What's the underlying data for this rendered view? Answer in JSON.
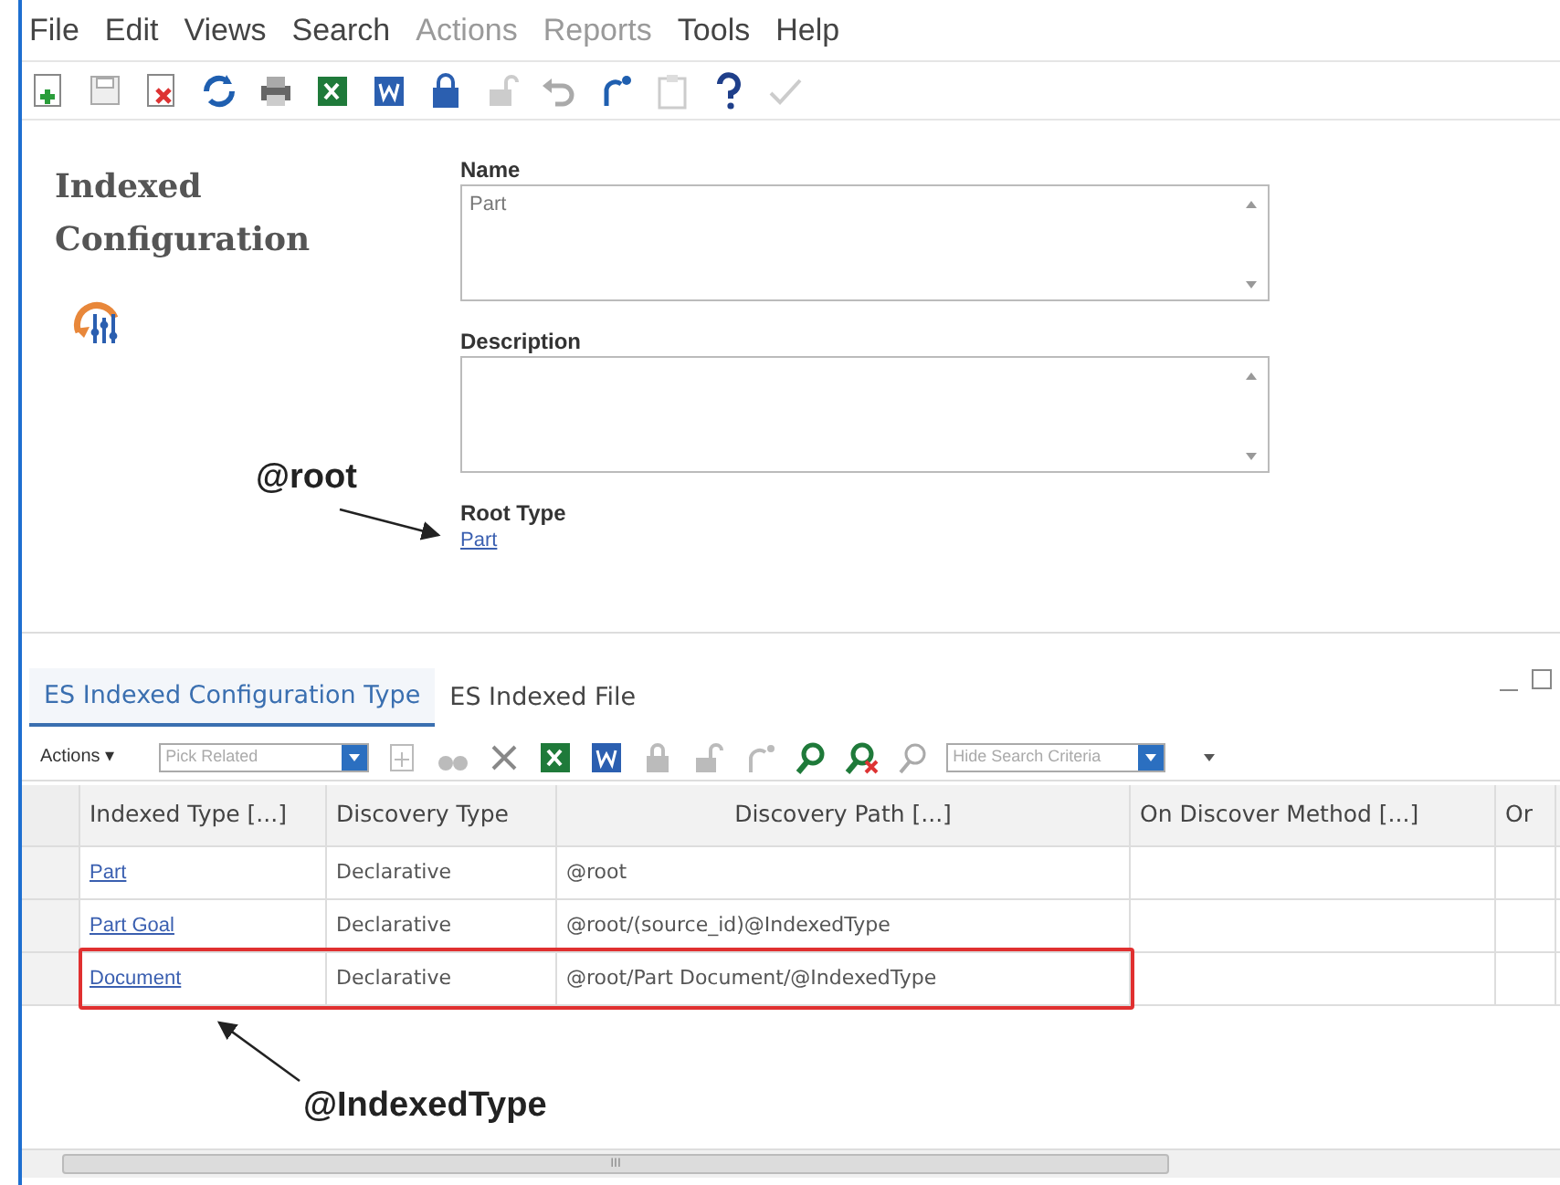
{
  "menu": [
    {
      "label": "File",
      "disabled": false
    },
    {
      "label": "Edit",
      "disabled": false
    },
    {
      "label": "Views",
      "disabled": false
    },
    {
      "label": "Search",
      "disabled": false
    },
    {
      "label": "Actions",
      "disabled": true
    },
    {
      "label": "Reports",
      "disabled": true
    },
    {
      "label": "Tools",
      "disabled": false
    },
    {
      "label": "Help",
      "disabled": false
    }
  ],
  "form": {
    "title": "Indexed Configuration",
    "name_label": "Name",
    "name_value": "Part",
    "description_label": "Description",
    "root_type_label": "Root Type",
    "root_type_value": "Part"
  },
  "annotations": [
    {
      "text": "@root"
    },
    {
      "text": "@IndexedType"
    }
  ],
  "tabs": [
    {
      "label": "ES Indexed Configuration Type",
      "selected": true
    },
    {
      "label": "ES Indexed File",
      "selected": false
    }
  ],
  "grid_toolbar": {
    "actions": "Actions",
    "actions_caret": "▾",
    "pick_related": "Pick Related",
    "search_criteria": "Hide Search Criteria"
  },
  "table": {
    "columns": [
      "Indexed Type [...]",
      "Discovery Type",
      "Discovery Path [...]",
      "On Discover Method [...]",
      "Or"
    ],
    "rows": [
      {
        "cells": [
          "Part",
          "Declarative",
          "@root"
        ],
        "highlighted": false
      },
      {
        "cells": [
          "Part Goal",
          "Declarative",
          "@root/(source_id)@IndexedType"
        ],
        "highlighted": false
      },
      {
        "cells": [
          "Document",
          "Declarative",
          "@root/Part Document/@IndexedType"
        ],
        "highlighted": true
      }
    ]
  },
  "scrollbar": {
    "grip": "III"
  }
}
